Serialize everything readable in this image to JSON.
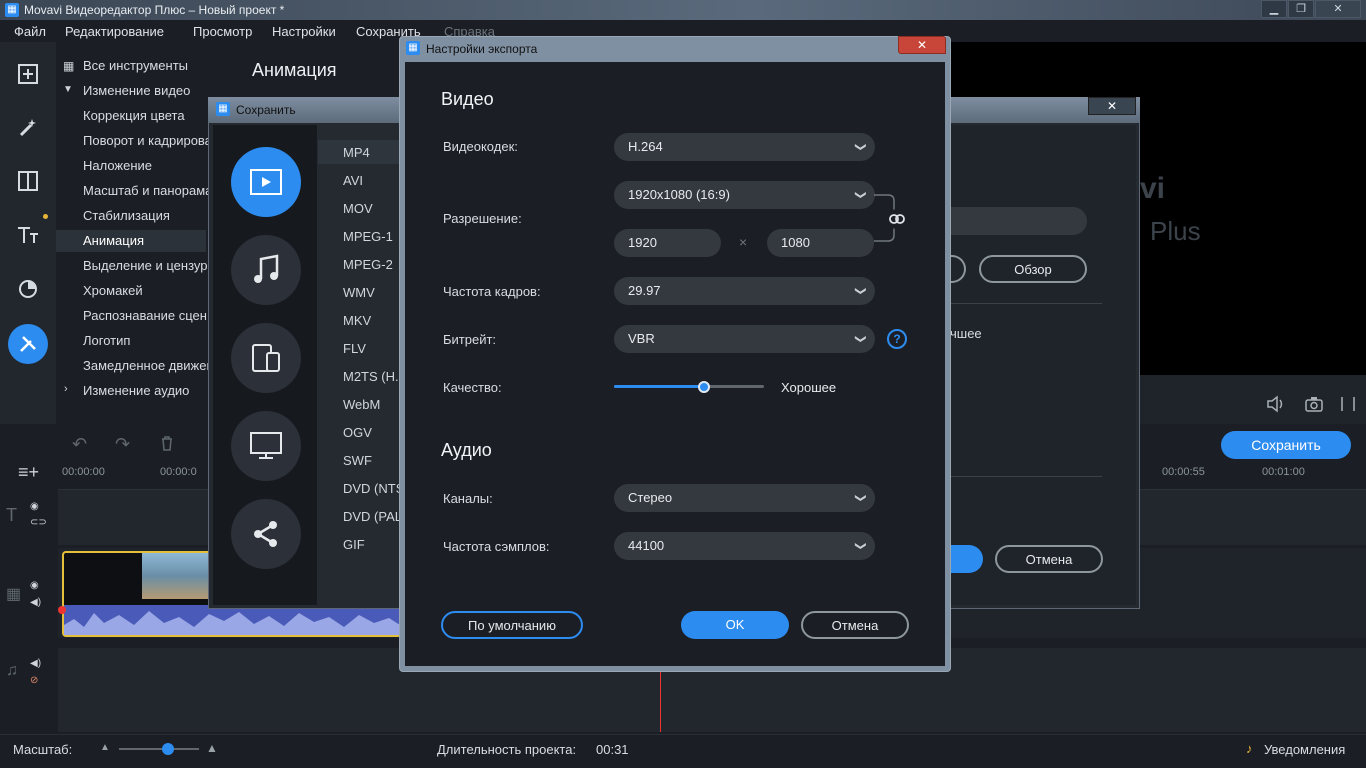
{
  "window": {
    "title": "Movavi Видеоредактор Плюс – Новый проект *",
    "min": "▁",
    "max": "❐",
    "close": "✕"
  },
  "menu": [
    "Файл",
    "Редактирование",
    "Просмотр",
    "Настройки",
    "Сохранить",
    "Справка"
  ],
  "tools": {
    "all_tools": "Все инструменты",
    "video_edit": "Изменение видео",
    "items": [
      "Коррекция цвета",
      "Поворот и кадрирование",
      "Наложение",
      "Масштаб и панорама",
      "Стабилизация",
      "Анимация",
      "Выделение и цензура",
      "Хромакей",
      "Распознавание сцен",
      "Логотип",
      "Замедленное движение"
    ],
    "audio_edit": "Изменение аудио"
  },
  "header": {
    "title": "Анимация"
  },
  "preview": {
    "watermark1": "vi",
    "watermark2": "Plus"
  },
  "timeline": {
    "ticks": [
      "00:00:00",
      "00:00:0",
      "00:00:55",
      "00:01:00"
    ]
  },
  "save_button": "Сохранить",
  "status": {
    "scale_label": "Масштаб:",
    "duration_label": "Длительность проекта:",
    "duration": "00:31",
    "notifications": "Уведомления"
  },
  "save_dialog": {
    "title": "Сохранить",
    "formats": [
      "MP4",
      "AVI",
      "MOV",
      "MPEG-1",
      "MPEG-2",
      "WMV",
      "MKV",
      "FLV",
      "M2TS (H.",
      "WebM",
      "OGV",
      "SWF",
      "DVD (NTS",
      "DVD (PAL",
      "GIF"
    ],
    "browse": "Обзор",
    "cancel": "Отмена",
    "partial_text": "чшее"
  },
  "export_dialog": {
    "title": "Настройки экспорта",
    "video_section": "Видео",
    "codec_label": "Видеокодек:",
    "codec": "H.264",
    "resolution_label": "Разрешение:",
    "resolution": "1920x1080 (16:9)",
    "width": "1920",
    "times": "×",
    "height": "1080",
    "framerate_label": "Частота кадров:",
    "framerate": "29.97",
    "bitrate_label": "Битрейт:",
    "bitrate": "VBR",
    "quality_label": "Качество:",
    "quality_value": "Хорошее",
    "quality_level": 0.6,
    "audio_section": "Аудио",
    "channels_label": "Каналы:",
    "channels": "Стерео",
    "samplerate_label": "Частота сэмплов:",
    "samplerate": "44100",
    "default_btn": "По умолчанию",
    "ok_btn": "OK",
    "cancel_btn": "Отмена",
    "close": "✕",
    "help": "?"
  },
  "colors": {
    "accent": "#2d8cf0",
    "clip_border": "#e4bf3a"
  }
}
